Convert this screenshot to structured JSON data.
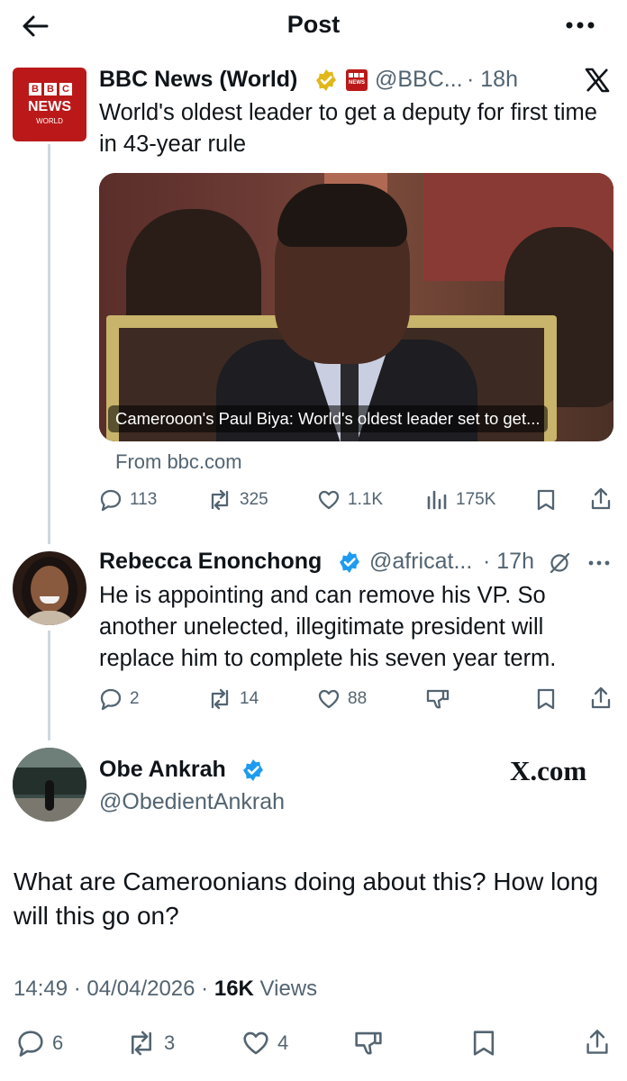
{
  "header": {
    "title": "Post"
  },
  "quoted": {
    "name": "BBC News (World)",
    "handle": "@BBC...",
    "time": "· 18h",
    "avatar": {
      "line1": [
        "B",
        "B",
        "C"
      ],
      "line2": "NEWS",
      "line3": "WORLD"
    },
    "text": "World's oldest leader to get a deputy for first time in 43-year rule",
    "card_caption": "Camerooon's Paul Biya: World's oldest leader set to get...",
    "card_from": "From bbc.com",
    "stats": {
      "replies": "113",
      "reposts": "325",
      "likes": "1.1K",
      "views": "175K"
    }
  },
  "reply": {
    "name": "Rebecca Enonchong",
    "handle": "@africat...",
    "time": "· 17h",
    "text": "He is appointing and can remove his VP. So another unelected, illegitimate president will replace him to complete his seven year term.",
    "stats": {
      "replies": "2",
      "reposts": "14",
      "likes": "88"
    }
  },
  "main": {
    "name": "Obe Ankrah",
    "handle": "@ObedientAnkrah",
    "watermark": "X.com",
    "text": "What are Cameroonians doing about this? How long will this go on?",
    "timestamp": "14:49 · 04/04/2026 ·",
    "views_count": "16K",
    "views_label": "Views",
    "stats": {
      "replies": "6",
      "reposts": "3",
      "likes": "4"
    }
  },
  "colors": {
    "accent": "#1d9bf0",
    "gold": "#e2b719",
    "bbc_red": "#bb1919",
    "muted": "#536471"
  }
}
